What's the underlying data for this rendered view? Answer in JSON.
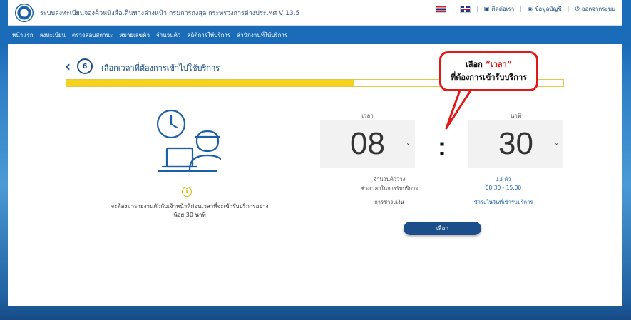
{
  "header": {
    "site_title": "ระบบลงทะเบียนจองคิวหนังสือเดินทางล่วงหน้า กรมการกงสุล กระทรวงการต่างประเทศ V 13.5",
    "contact_label": "ติดต่อเรา",
    "profile_label": "ข้อมูลบัญชี",
    "logout_label": "ออกจากระบบ"
  },
  "nav": {
    "items": [
      {
        "label": "หน้าแรก"
      },
      {
        "label": "ลงทะเบียน"
      },
      {
        "label": "ตรวจสอบสถานะ"
      },
      {
        "label": "หมายเลขคิว"
      },
      {
        "label": "จำนวนคิว"
      },
      {
        "label": "สถิติการให้บริการ"
      },
      {
        "label": "สำนักงานที่ให้บริการ"
      }
    ]
  },
  "step": {
    "number": "6",
    "title": "เลือกเวลาที่ต้องการเข้าไปใช้บริการ",
    "progress": 0.58
  },
  "info": {
    "text": "จะต้องมารายงานตัวกับเจ้าหน้าที่ก่อนเวลาที่จะเข้ารับบริการอย่างน้อย 30 นาที"
  },
  "picker": {
    "hour_label": "เวลา",
    "minute_label": "นาที",
    "hour_value": "08",
    "minute_value": "30",
    "separator": ":"
  },
  "details": {
    "available_label": "จำนวนคิวว่าง",
    "available_value": "13 คิว",
    "period_label": "ช่วงเวลาในการรับบริการ",
    "period_value": "08.30 - 15.00",
    "payment_label": "การชำระเงิน",
    "payment_value": "ชำระในวันที่เข้ารับบริการ"
  },
  "actions": {
    "select_label": "เลือก"
  },
  "callout": {
    "line1_prefix": "เลือก ",
    "line1_highlight": "“เวลา”",
    "line2": "ที่ต้องการเข้ารับบริการ"
  },
  "colors": {
    "primary": "#1b4e8a",
    "progress": "#f7d21d",
    "callout_border": "#e01818"
  }
}
